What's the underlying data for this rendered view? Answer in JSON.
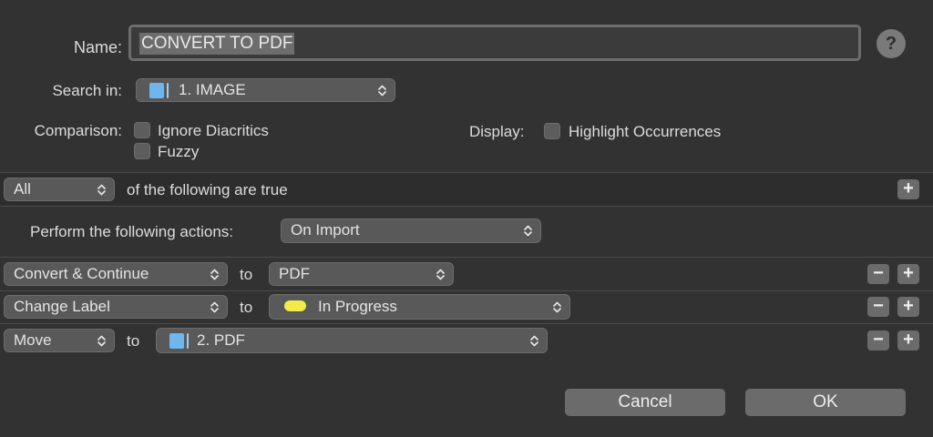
{
  "form": {
    "name_label": "Name:",
    "name_value": "CONVERT TO PDF",
    "help_label": "?",
    "search_in_label": "Search in:",
    "search_in_value": "1. IMAGE",
    "comparison_label": "Comparison:",
    "ignore_diacritics_label": "Ignore Diacritics",
    "fuzzy_label": "Fuzzy",
    "display_label": "Display:",
    "highlight_label": "Highlight Occurrences"
  },
  "conditions": {
    "match_value": "All",
    "suffix": "of the following are true",
    "add_label": "+"
  },
  "actions": {
    "perform_label": "Perform the following actions:",
    "trigger_value": "On Import",
    "rows": [
      {
        "action": "Convert & Continue",
        "to": "to",
        "target": "PDF"
      },
      {
        "action": "Change Label",
        "to": "to",
        "target": "In Progress",
        "label_color": "#f2eb4a"
      },
      {
        "action": "Move",
        "to": "to",
        "target": "2. PDF"
      }
    ],
    "remove_label": "−",
    "add_label": "+"
  },
  "footer": {
    "cancel_label": "Cancel",
    "ok_label": "OK"
  },
  "colors": {
    "background": "#323232",
    "folder": "#6db6ee"
  }
}
